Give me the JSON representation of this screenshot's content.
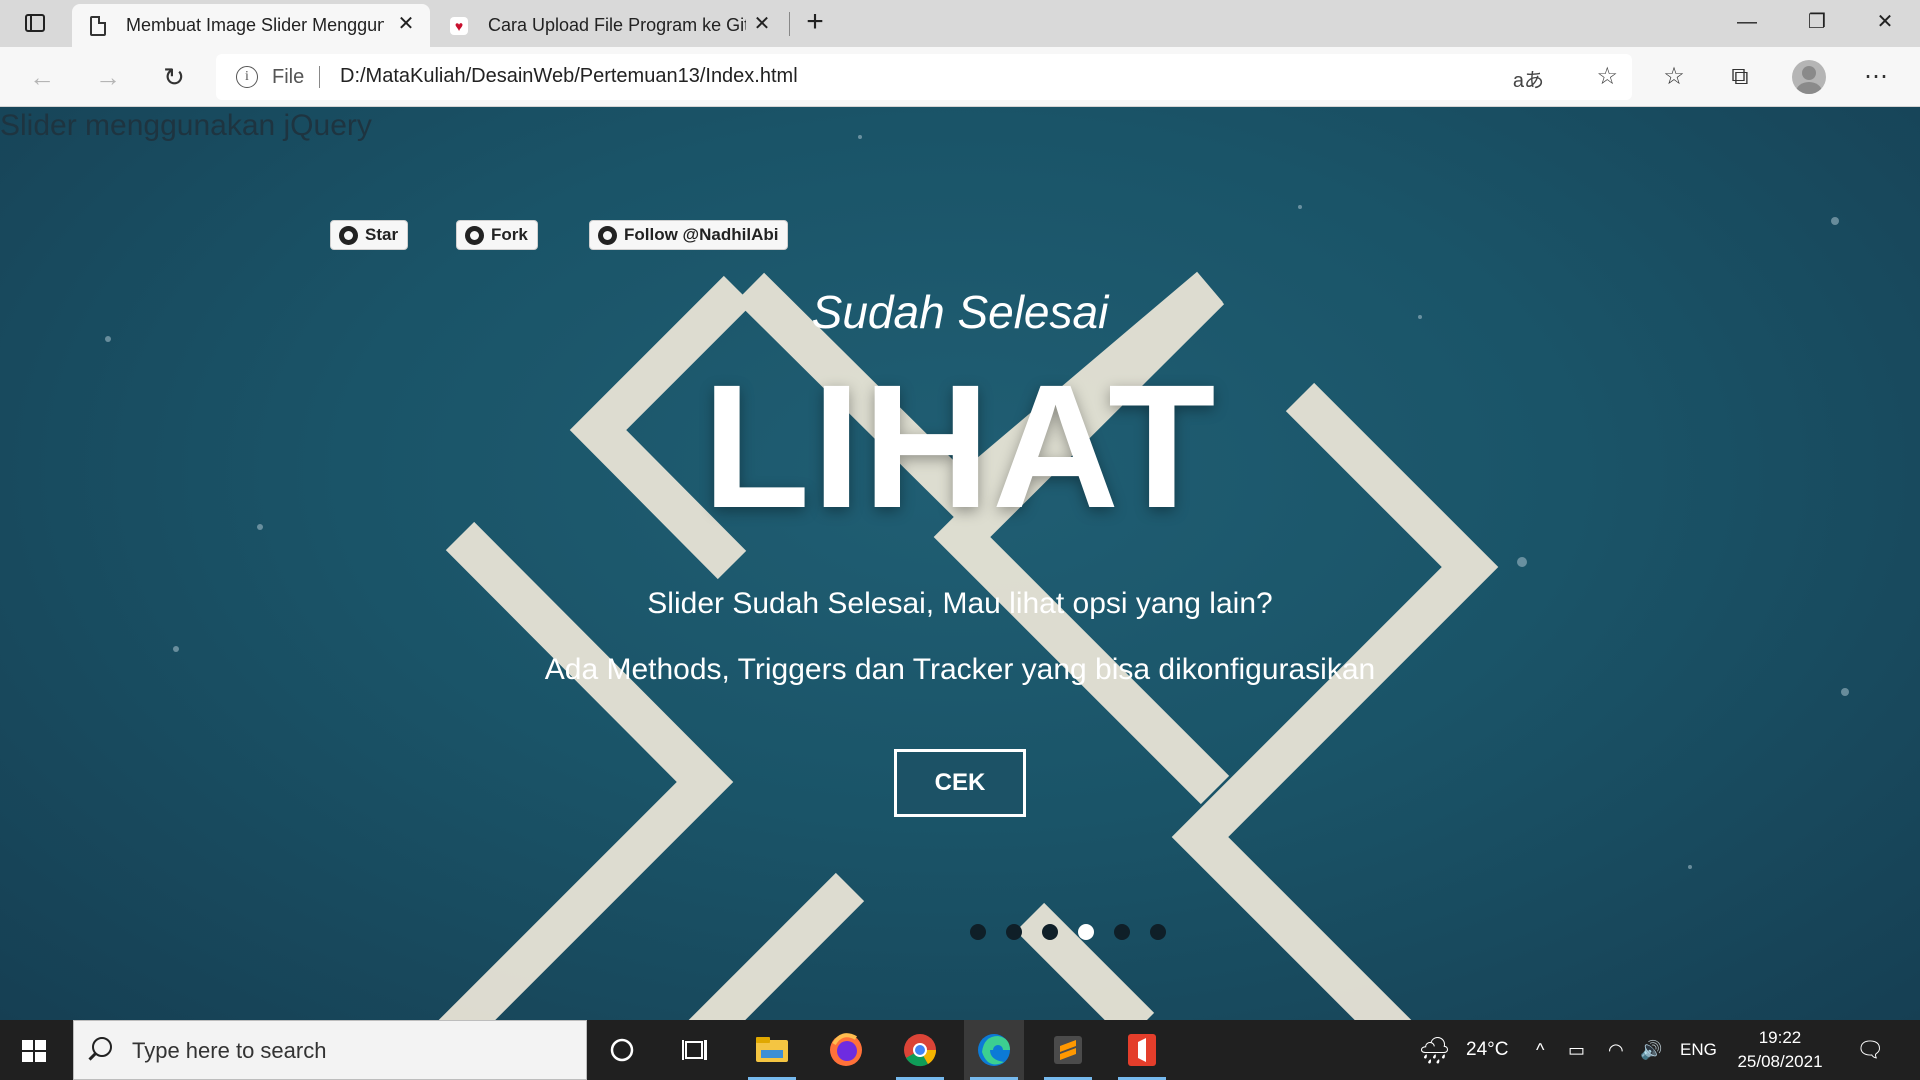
{
  "browser": {
    "tabs": [
      {
        "title": "Membuat Image Slider Menggun",
        "active": true
      },
      {
        "title": "Cara Upload File Program ke Git",
        "active": false
      }
    ],
    "address": {
      "scheme_label": "File",
      "url": "D:/MataKuliah/DesainWeb/Pertemuan13/Index.html"
    },
    "window_controls": [
      "minimize-icon",
      "restore-icon",
      "close-icon"
    ]
  },
  "page": {
    "heading": "Slider menggunakan jQuery",
    "github_buttons": [
      {
        "label": "Star"
      },
      {
        "label": "Fork"
      },
      {
        "label": "Follow @NadhilAbi"
      }
    ],
    "slide": {
      "subtitle": "Sudah Selesai",
      "hero": "LIHAT",
      "desc1": "Slider Sudah Selesai, Mau lihat opsi yang lain?",
      "desc2": "Ada Methods, Triggers dan Tracker yang bisa dikonfigurasikan",
      "button": "CEK"
    },
    "slider_dots": {
      "count": 6,
      "active_index": 3
    }
  },
  "taskbar": {
    "search_placeholder": "Type here to search",
    "weather": "24°C",
    "language": "ENG",
    "time": "19:22",
    "date": "25/08/2021"
  }
}
